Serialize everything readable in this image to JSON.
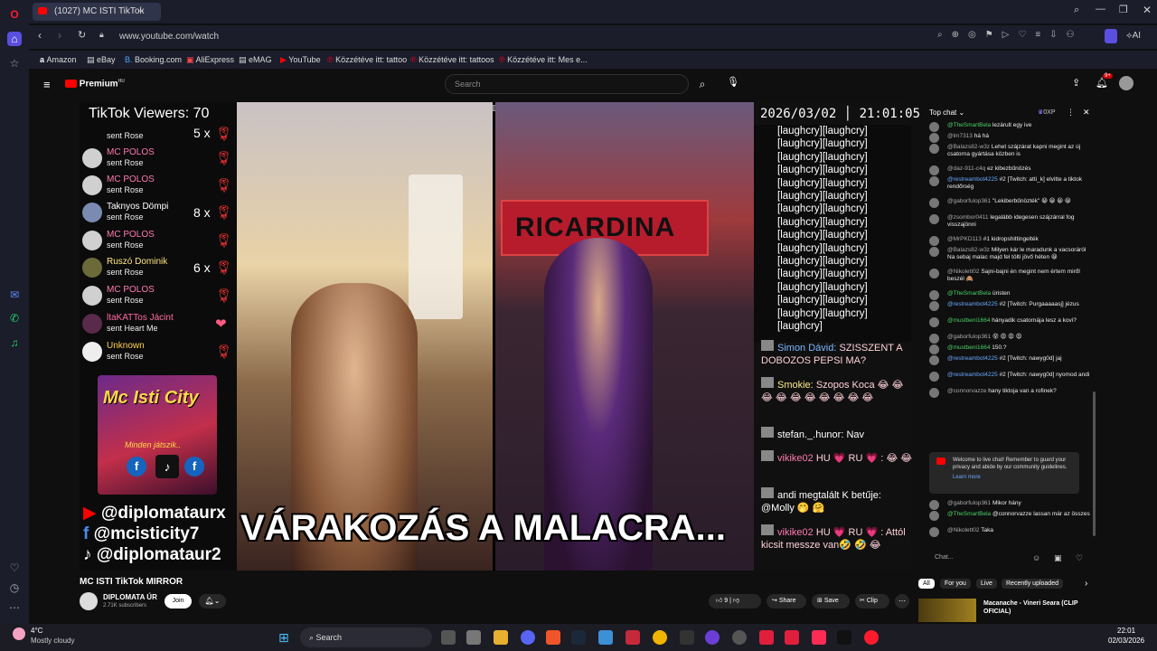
{
  "browser": {
    "tab_title": "(1027) MC ISTI TikTok",
    "url": "www.youtube.com/watch",
    "ai_label": "AI",
    "bookmarks": [
      "Amazon",
      "eBay",
      "Booking.com",
      "AliExpress",
      "eMAG",
      "YouTube",
      "Közzétéve itt: tattoo",
      "Közzétéve itt: tattoos",
      "Közzétéve itt: Mes e..."
    ]
  },
  "youtube": {
    "logo": "Premium",
    "logo_sup": "HU",
    "search_placeholder": "Search",
    "notification_badge": "9+"
  },
  "stream": {
    "viewers": "TikTok Viewers: 70",
    "datetime": "2026/03/02 │ 21:01:05",
    "banner": "VÁRAKOZÁS A MALACRA...",
    "socials": [
      "@diplomataurx",
      "@mcisticity7",
      "@diplomataur2"
    ],
    "poster_title": "Mc Isti City",
    "poster_sub": "Minden játszik..",
    "shop_sign": "RICARDINA",
    "gifts": [
      {
        "name": "MC POLOS",
        "action": "sent Rose",
        "count": ""
      },
      {
        "name": "MC POLOS",
        "action": "sent Rose",
        "count": ""
      },
      {
        "name": "Taknyos Dömpi",
        "action": "sent Rose",
        "count": "8 x"
      },
      {
        "name": "MC POLOS",
        "action": "sent Rose",
        "count": ""
      },
      {
        "name": "Ruszó Dominik",
        "action": "sent Rose",
        "count": "6 x"
      },
      {
        "name": "MC POLOS",
        "action": "sent Rose",
        "count": ""
      },
      {
        "name": "ltaKATTos Jácint",
        "action": "sent Heart Me",
        "count": ""
      },
      {
        "name": "Unknown",
        "action": "sent Rose",
        "count": ""
      }
    ],
    "top_gift": {
      "action": "sent Rose",
      "count": "5 x"
    },
    "laugh_block": "[laughcry][laughcry] [laughcry][laughcry] [laughcry][laughcry] [laughcry][laughcry] [laughcry][laughcry] [laughcry][laughcry] [laughcry][laughcry] [laughcry][laughcry] [laughcry][laughcry] [laughcry][laughcry] [laughcry][laughcry] [laughcry][laughcry] [laughcry][laughcry] [laughcry][laughcry] [laughcry][laughcry] [laughcry]",
    "messages": [
      {
        "user": "Simon Dávid:",
        "text": "SZISSZENT A DOBOZOS PEPSI MA?"
      },
      {
        "user": "Smokie:",
        "text": "Szopos Koca 😂 😂 😂 😂 😂 😂 😂 😂 😂 😂"
      },
      {
        "user": "stefan._.hunor:",
        "text": "Nav"
      },
      {
        "user": "vikike02",
        "text": "HU 💗 RU 💗 : 😂 😂"
      },
      {
        "user": "andi megtalált K betűje:",
        "text": "@Molly 🤭 🤗"
      },
      {
        "user": "vikike02",
        "text": "HU 💗 RU 💗 : Attól kicsit messze van🤣 🤣 😂"
      }
    ]
  },
  "chat": {
    "header": "Top chat",
    "points": "0XP",
    "messages": [
      {
        "user": "@TheSmartBela",
        "text": "lezárult egy ive",
        "color": "green"
      },
      {
        "user": "@lm7313",
        "text": "há há",
        "color": "grey"
      },
      {
        "user": "@Balazs82-w3z",
        "text": "Lehet szájzárat kapni megint az új csatorna gyártása közben is",
        "color": "grey"
      },
      {
        "user": "@daz-911-c4q",
        "text": "ez kibezbűnözés",
        "color": "grey"
      },
      {
        "user": "@restreambot4225",
        "text": "#2 [Twitch: atti_k] elvitte a tiktok rendőrség",
        "color": "blue"
      },
      {
        "user": "@gaborfulop361",
        "text": "\"Lekiberbűnözték\" 😀 😀 😀 😀",
        "color": "grey"
      },
      {
        "user": "@zsombor0411",
        "text": "legalább idegesen szájzárral fog visszajönni",
        "color": "grey"
      },
      {
        "user": "@MrPKD113",
        "text": "#1 kidropshittingelték",
        "color": "grey"
      },
      {
        "user": "@Balazs82-w3z",
        "text": "Milyen kár le maradunk a vacsoráról Na sebaj malac majd fel tölti jövő héten 😀",
        "color": "grey"
      },
      {
        "user": "@Nikolett02",
        "text": "Sajni-bajni én megint nem értem miről beszél 🙈",
        "color": "grey"
      },
      {
        "user": "@TheSmartBela",
        "text": "üristen",
        "color": "green"
      },
      {
        "user": "@restreambot4225",
        "text": "#2 [Twitch: Purgaaaaasj] jézus",
        "color": "blue"
      },
      {
        "user": "@mustbeni1664",
        "text": "hányadik csatornája lesz a kovi?",
        "color": "green"
      },
      {
        "user": "@gaborfulop361",
        "text": "😵 😩 😩 😩",
        "color": "grey"
      },
      {
        "user": "@mustbeni1664",
        "text": "150.?",
        "color": "green"
      },
      {
        "user": "@restreambot4225",
        "text": "#2 [Twitch: nawyg0d] jaj",
        "color": "blue"
      },
      {
        "user": "@restreambot4225",
        "text": "#2 [Twitch: nawyg0d] nyomod andi",
        "color": "blue"
      },
      {
        "user": "@connorvazze",
        "text": "hany tiktoja van a rofinek?",
        "color": "grey"
      }
    ],
    "welcome": "Welcome to live chat! Remember to guard your privacy and abide by our community guidelines.",
    "learn_more": "Learn more",
    "messages2": [
      {
        "user": "@gaborfulop361",
        "text": "Mikor hány",
        "color": "grey"
      },
      {
        "user": "@TheSmartBela",
        "text": "@connorvazze lassan már az összes",
        "color": "green"
      },
      {
        "user": "@Nikolett02",
        "text": "Taka",
        "color": "grey"
      }
    ],
    "input_placeholder": "Chat..."
  },
  "video_info": {
    "title": "MC ISTI TikTok MIRROR",
    "channel": "DIPLOMATA ÚR",
    "subscribers": "2.71K subscribers",
    "join": "Join",
    "likes": "9",
    "share": "Share",
    "save": "Save",
    "clip": "Clip"
  },
  "recommend": {
    "chips": [
      "All",
      "For you",
      "Live",
      "Recently uploaded"
    ],
    "next_title": "Macanache - Vineri Seara (CLIP OFICIAL)"
  },
  "taskbar": {
    "temp": "4°C",
    "weather": "Mostly cloudy",
    "search": "Search",
    "time": "22:01",
    "date": "02/03/2026"
  }
}
